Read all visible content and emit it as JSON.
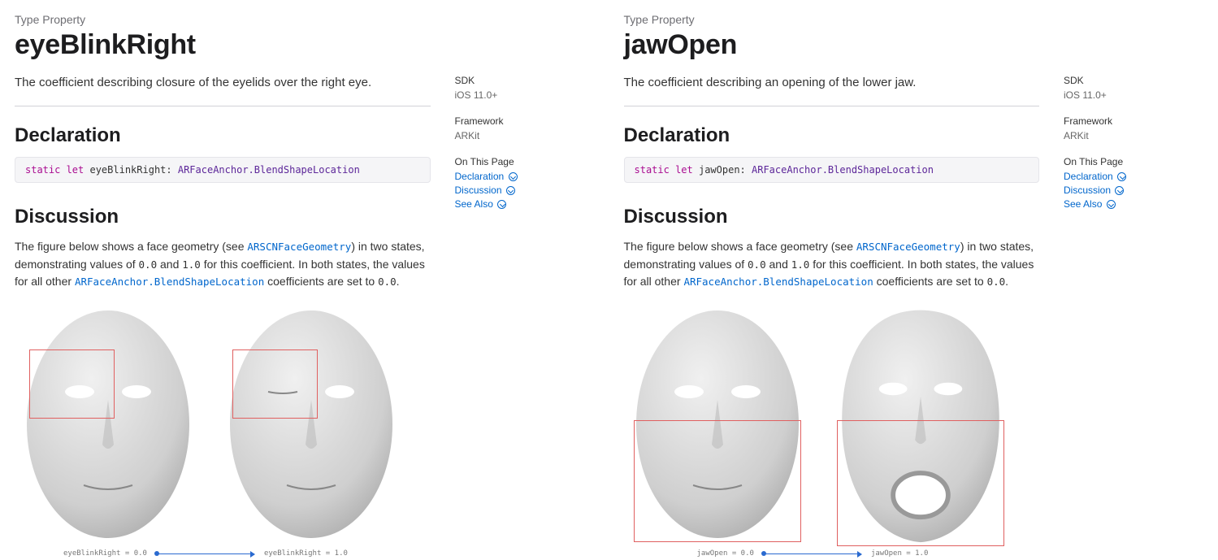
{
  "pages": [
    {
      "eyebrow": "Type Property",
      "title": "eyeBlinkRight",
      "summary": "The coefficient describing closure of the eyelids over the right eye.",
      "declaration_heading": "Declaration",
      "decl_kw": "static let",
      "decl_name": " eyeBlinkRight: ",
      "decl_type": "ARFaceAnchor.BlendShapeLocation",
      "discussion_heading": "Discussion",
      "disc_pre": "The figure below shows a face geometry (see ",
      "disc_link1": "ARSCNFaceGeometry",
      "disc_mid1": ") in two states, demonstrating values of ",
      "disc_v0": "0.0",
      "disc_and": " and ",
      "disc_v1": "1.0",
      "disc_mid2": " for this coefficient. In both states, the values for all other ",
      "disc_link2": "ARFaceAnchor.BlendShapeLocation",
      "disc_tail": " coefficients are set to ",
      "disc_v0b": "0.0",
      "disc_period": ".",
      "caption_left": "eyeBlinkRight = 0.0",
      "caption_right": "eyeBlinkRight = 1.0",
      "side": {
        "sdk_label": "SDK",
        "sdk_value": "iOS 11.0+",
        "fw_label": "Framework",
        "fw_value": "ARKit",
        "otp_label": "On This Page",
        "links": [
          "Declaration",
          "Discussion",
          "See Also"
        ]
      }
    },
    {
      "eyebrow": "Type Property",
      "title": "jawOpen",
      "summary": "The coefficient describing an opening of the lower jaw.",
      "declaration_heading": "Declaration",
      "decl_kw": "static let",
      "decl_name": " jawOpen: ",
      "decl_type": "ARFaceAnchor.BlendShapeLocation",
      "discussion_heading": "Discussion",
      "disc_pre": "The figure below shows a face geometry (see ",
      "disc_link1": "ARSCNFaceGeometry",
      "disc_mid1": ") in two states, demonstrating values of ",
      "disc_v0": "0.0",
      "disc_and": " and ",
      "disc_v1": "1.0",
      "disc_mid2": " for this coefficient. In both states, the values for all other ",
      "disc_link2": "ARFaceAnchor.BlendShapeLocation",
      "disc_tail": " coefficients are set to ",
      "disc_v0b": "0.0",
      "disc_period": ".",
      "caption_left": "jawOpen = 0.0",
      "caption_right": "jawOpen = 1.0",
      "side": {
        "sdk_label": "SDK",
        "sdk_value": "iOS 11.0+",
        "fw_label": "Framework",
        "fw_value": "ARKit",
        "otp_label": "On This Page",
        "links": [
          "Declaration",
          "Discussion",
          "See Also"
        ]
      }
    }
  ]
}
